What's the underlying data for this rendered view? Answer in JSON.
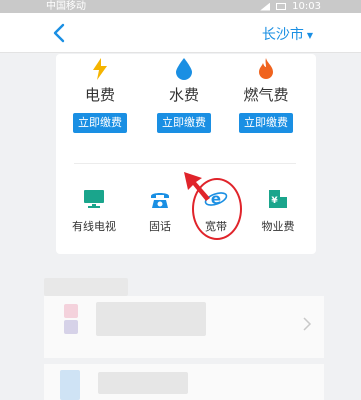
{
  "status_bar": {
    "carrier": "中国移动",
    "time": "10:03"
  },
  "header": {
    "city": "长沙市"
  },
  "bills": [
    {
      "label": "电费",
      "pay_label": "立即缴费",
      "icon": "lightning-icon",
      "color": "#f5b400"
    },
    {
      "label": "水费",
      "pay_label": "立即缴费",
      "icon": "water-drop-icon",
      "color": "#1a8fe3"
    },
    {
      "label": "燃气费",
      "pay_label": "立即缴费",
      "icon": "flame-icon",
      "color": "#f0631e"
    }
  ],
  "services": [
    {
      "label": "有线电视",
      "icon": "tv-icon",
      "color": "#1aa58c"
    },
    {
      "label": "固话",
      "icon": "telephone-icon",
      "color": "#1a8fe3"
    },
    {
      "label": "宽带",
      "icon": "broadband-icon",
      "color": "#1a8fe3"
    },
    {
      "label": "物业费",
      "icon": "building-icon",
      "color": "#1aa58c"
    }
  ],
  "colors": {
    "accent": "#1a8fe3",
    "annotation": "#e0242b"
  }
}
